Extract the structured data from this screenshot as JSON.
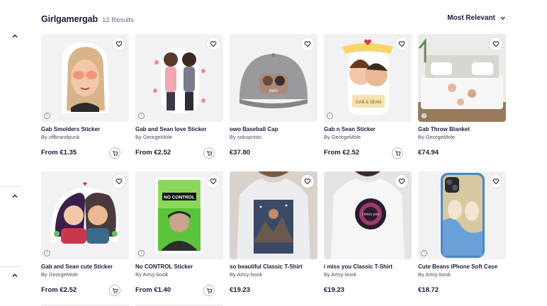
{
  "header": {
    "title": "Girlgamergab",
    "results": "12 Results",
    "sort_label": "Most Relevant"
  },
  "products": [
    {
      "title": "Gab Smolders Sticker",
      "by": "By offbrandpunk",
      "price": "From €1.35",
      "cart": true
    },
    {
      "title": "Gab and Sean love Sticker",
      "by": "By GeorgeMole",
      "price": "From €2.52",
      "cart": true
    },
    {
      "title": "owo Baseball Cap",
      "by": "By sokoprints",
      "price": "€37.80",
      "cart": false
    },
    {
      "title": "Gab n Sean Sticker",
      "by": "By GeorgeMole",
      "price": "From €2.52",
      "cart": true
    },
    {
      "title": "Gab Throw Blanket",
      "by": "By GeorgeMole",
      "price": "€74.94",
      "cart": false
    },
    {
      "title": "Gab and Sean cute Sticker",
      "by": "By GeorgeMole",
      "price": "From €2.52",
      "cart": true
    },
    {
      "title": "No CONTROL Sticker",
      "by": "By Artsy-book",
      "price": "From €1.40",
      "cart": true
    },
    {
      "title": "so beautiful Classic T-Shirt",
      "by": "By Artsy-book",
      "price": "€19.23",
      "cart": false
    },
    {
      "title": "i miss you Classic T-Shirt",
      "by": "By Artsy-book",
      "price": "€19.23",
      "cart": false
    },
    {
      "title": "Cute Beans iPhone Soft Case",
      "by": "By Artsy-book",
      "price": "€18.72",
      "cart": false
    }
  ],
  "artwork_text": {
    "cap_patch": "owo",
    "sticker_banner": "GAB & SEAN",
    "no_control": "NO CONTROL",
    "miss_you": "i miss you"
  },
  "colors": {
    "text_primary": "#1c1b3a",
    "text_secondary": "#4a4a5c",
    "thumb_bg": "#f2f2f4"
  },
  "icons": [
    "chevron-up-icon",
    "chevron-down-icon",
    "heart-icon",
    "info-icon",
    "cart-icon"
  ]
}
